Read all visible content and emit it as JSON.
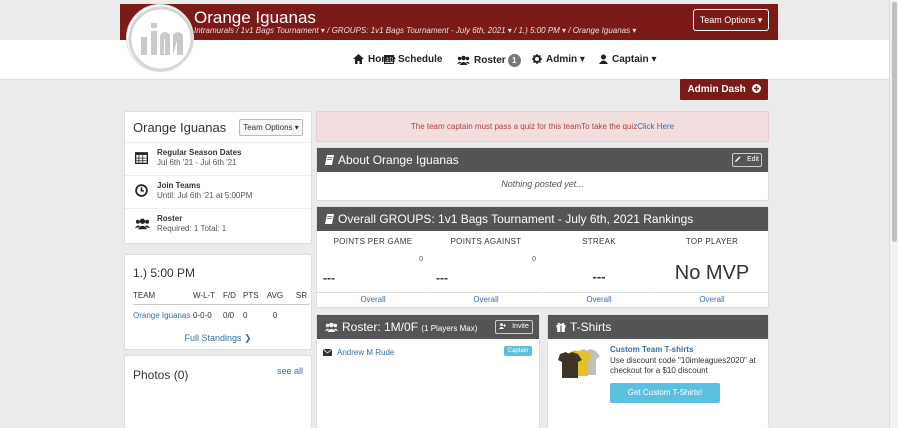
{
  "header": {
    "team_name": "Orange Iguanas",
    "breadcrumb": "Intramurals /   1v1 Bags Tournament ▾ /   GROUPS: 1v1 Bags Tournament - July 6th, 2021 ▾ /   1.) 5:00 PM ▾ /   Orange Iguanas ▾",
    "team_options": "Team Options ▾"
  },
  "nav": {
    "home": "Home",
    "schedule": "Schedule",
    "roster": "Roster",
    "roster_count": "1",
    "admin": "Admin ▾",
    "captain": "Captain ▾"
  },
  "admin_dash": "Admin Dash",
  "team_card": {
    "title": "Orange Iguanas",
    "options": "Team Options ▾",
    "rows": [
      {
        "label": "Regular Season Dates",
        "sub": "Jul 6th '21 - Jul 6th '21"
      },
      {
        "label": "Join Teams",
        "sub": "Until: Jul 6th '21 at 5:00PM"
      },
      {
        "label": "Roster",
        "sub": "Required: 1  Total: 1"
      }
    ]
  },
  "standings": {
    "title": "1.) 5:00 PM",
    "headers": [
      "TEAM",
      "W-L-T",
      "F/D",
      "PTS",
      "AVG",
      "SR"
    ],
    "rows": [
      [
        "Orange Iguanas",
        "0-0-0",
        "0/0",
        "0",
        "0",
        ""
      ]
    ],
    "full_link": "Full Standings ❯"
  },
  "photos": {
    "title": "Photos (0)",
    "see_all": "see all"
  },
  "alert": {
    "text": "The team captain must pass a quiz for this teamTo take the quiz",
    "link": "Click Here"
  },
  "about": {
    "title": "About Orange Iguanas",
    "edit": "Edit",
    "body": "Nothing posted yet..."
  },
  "rankings": {
    "title": "Overall GROUPS: 1v1 Bags Tournament - July 6th, 2021 Rankings",
    "columns": [
      {
        "header": "POINTS PER GAME",
        "num": "0",
        "value": "---",
        "link": "Overall"
      },
      {
        "header": "POINTS AGAINST",
        "num": "0",
        "value": "---",
        "link": "Overall"
      },
      {
        "header": "STREAK",
        "num": "",
        "value": "---",
        "link": "Overall"
      },
      {
        "header": "TOP PLAYER",
        "num": "",
        "value": "No MVP",
        "link": "Overall"
      }
    ]
  },
  "roster": {
    "title": "Roster: 1M/0F",
    "max": "(1 Players Max)",
    "invite": "Invite",
    "player": "Andrew M Rude",
    "tag": "Captain"
  },
  "tshirts": {
    "title": "T-Shirts",
    "promo_title": "Custom Team T-shirts",
    "promo_text": "Use discount code \"10imleagues2020\" at checkout for a $10 discount",
    "button": "Get Custom T-Shirts!"
  },
  "colors": {
    "brand": "#7a1b17",
    "link": "#3a6ea5",
    "info": "#5bc0de"
  }
}
